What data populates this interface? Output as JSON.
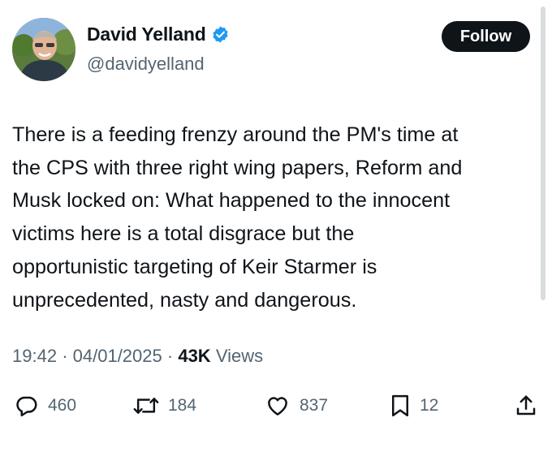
{
  "author": {
    "display_name": "David Yelland",
    "handle": "@davidyelland",
    "verified_icon": "verified-badge-icon",
    "avatar_icon": "profile-photo"
  },
  "follow_label": "Follow",
  "tweet": {
    "lines": [
      "There is a feeding frenzy around the PM's time at",
      "the CPS with three right wing papers, Reform and",
      "Musk locked on: What happened to the innocent",
      "victims here is a total disgrace but the",
      "opportunistic targeting of Keir Starmer is",
      "unprecedented, nasty and dangerous."
    ]
  },
  "meta": {
    "time": "19:42",
    "separator": "·",
    "date": "04/01/2025",
    "views_count": "43K",
    "views_label": "Views"
  },
  "actions": {
    "replies": {
      "icon": "reply-icon",
      "count": "460"
    },
    "reposts": {
      "icon": "repost-icon",
      "count": "184"
    },
    "likes": {
      "icon": "like-icon",
      "count": "837"
    },
    "bookmarks": {
      "icon": "bookmark-icon",
      "count": "12"
    },
    "share": {
      "icon": "share-icon"
    }
  },
  "colors": {
    "text": "#0f1419",
    "secondary": "#536471",
    "verified": "#1d9bf0",
    "follow_bg": "#0f1419"
  }
}
